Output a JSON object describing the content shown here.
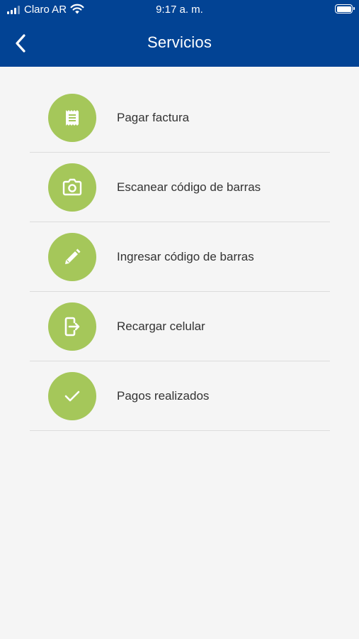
{
  "status_bar": {
    "carrier": "Claro AR",
    "time": "9:17 a. m."
  },
  "nav": {
    "title": "Servicios",
    "back_icon": "chevron-left-icon"
  },
  "menu": [
    {
      "label": "Pagar factura",
      "icon": "receipt-icon"
    },
    {
      "label": "Escanear código de barras",
      "icon": "camera-icon"
    },
    {
      "label": "Ingresar código de barras",
      "icon": "pencil-icon"
    },
    {
      "label": "Recargar celular",
      "icon": "phone-topup-icon"
    },
    {
      "label": "Pagos realizados",
      "icon": "check-icon"
    }
  ],
  "colors": {
    "header": "#024394",
    "icon_circle": "#a5c75a",
    "background": "#f5f5f5",
    "divider": "#dcdcdc"
  }
}
